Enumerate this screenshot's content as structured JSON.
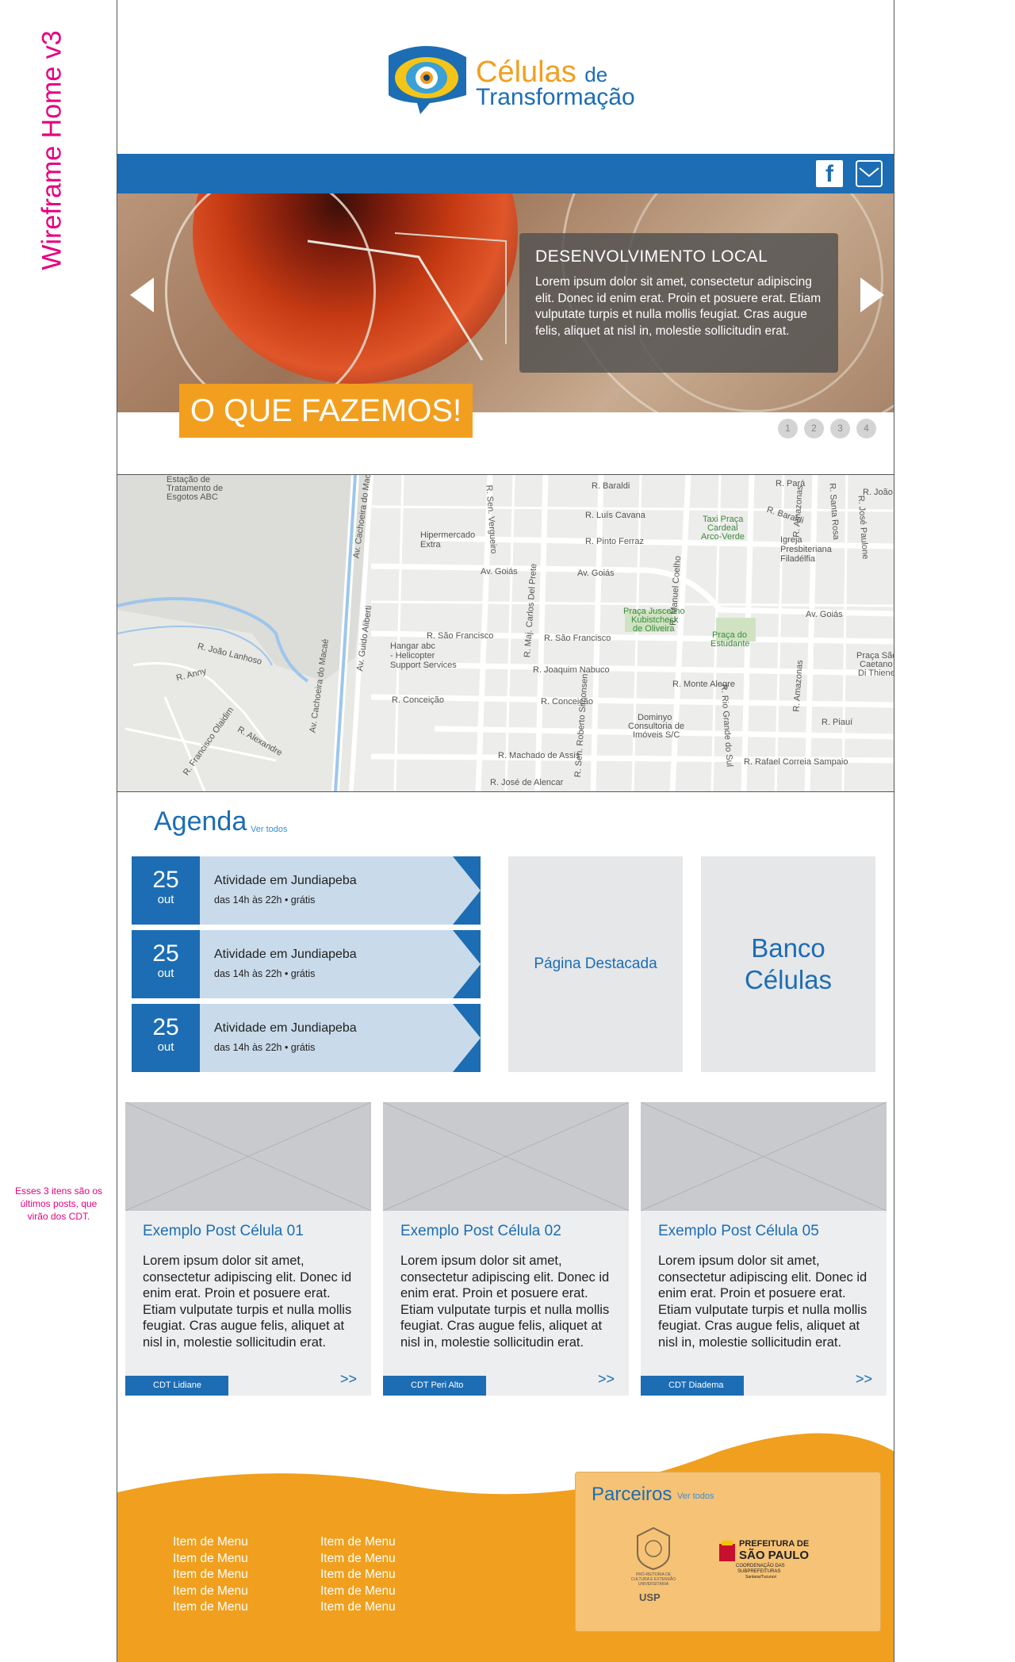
{
  "annotation": {
    "title": "Wireframe Home v3",
    "side_note": "Esses 3 itens são os últimos posts, que virão dos CDT."
  },
  "header": {
    "logo_line1": "Células",
    "logo_line1_small": "de",
    "logo_line2": "Transformação",
    "social": {
      "facebook_glyph": "f",
      "icons": [
        "facebook-icon",
        "mail-icon"
      ]
    }
  },
  "hero": {
    "caption_title": "DESENVOLVIMENTO LOCAL",
    "caption_body": "Lorem ipsum dolor sit amet, consectetur adipiscing elit. Donec id enim erat. Proin et posuere erat. Etiam vulputate turpis et nulla mollis feugiat. Cras augue felis, aliquet at nisl in, molestie sollicitudin erat.",
    "cta_label": "O QUE FAZEMOS!",
    "pages": [
      "1",
      "2",
      "3",
      "4"
    ]
  },
  "map": {
    "labels": {
      "estacao": "Estação de",
      "tratamento": "Tratamento de",
      "esgotos": "Esgotos ABC",
      "hiper1": "Hipermercado",
      "hiper2": "Extra",
      "goias1": "Av. Goiás",
      "goias2": "Av. Goiás",
      "goias3": "Av. Goiás",
      "baraldi1": "R. Baraldi",
      "baraldi2": "R. Baraldi",
      "luis": "R. Luís Cavana",
      "pinto": "R. Pinto Ferraz",
      "saofrancisco1": "R. São Francisco",
      "saofrancisco2": "R. São Francisco",
      "hangar1": "Hangar abc",
      "hangar2": "- Helicopter",
      "hangar3": "Support Services",
      "joaquim": "R. Joaquim Nabuco",
      "conceicao1": "R. Conceição",
      "conceicao2": "R. Conceição",
      "machado": "R. Machado de Assis",
      "jose": "R. José de Alencar",
      "praca1": "Praça Juscelino",
      "praca2": "Kubistcheck",
      "praca3": "de Oliveira",
      "praca_est1": "Praça do",
      "praca_est2": "Estudante",
      "taxi1": "Taxi Praça",
      "taxi2": "Cardeal",
      "taxi3": "Arco-Verde",
      "igreja1": "Igreja",
      "igreja2": "Presbiteriana",
      "igreja3": "Filadélfia",
      "montealegre": "R. Monte Alegre",
      "dominyo1": "Dominyo",
      "dominyo2": "Consultoria de",
      "dominyo3": "Imóveis S/C",
      "rafael": "R. Rafael Correia Sampaio",
      "piaui": "R. Piauí",
      "para": "R. Pará",
      "joao": "R. João",
      "lanhoso": "R. João Lanhoso",
      "anny": "R. Anny",
      "alexandre": "R. Alexandre",
      "olavo": "R. Francisco Olaidim",
      "pracasao1": "Praça São",
      "pracasao2": "Caetano",
      "pracasao3": "Di Thiene",
      "cachoeira": "Av. Cachoeira do Macaé",
      "guido": "Av. Guido Aliberti",
      "verguero": "R. Sen. Vergueiro",
      "delprete": "R. Maj. Carlos Del Prete",
      "simonsen": "R. Sen. Roberto Simonsen",
      "coelho": "R. Manuel Coelho",
      "amazonas": "R. Amazonas",
      "amazonas2": "R. Amazonas",
      "santarosa": "R. Santa Rosa",
      "paulone": "R. José Paulone",
      "riogrande": "R. Rio Grande do Sul"
    }
  },
  "agenda": {
    "title": "Agenda",
    "see_all": "Ver todos",
    "events": [
      {
        "day": "25",
        "month": "out",
        "title": "Atividade em Jundiapeba",
        "time": "das 14h às 22h • grátis"
      },
      {
        "day": "25",
        "month": "out",
        "title": "Atividade em Jundiapeba",
        "time": "das 14h às 22h • grátis"
      },
      {
        "day": "25",
        "month": "out",
        "title": "Atividade em Jundiapeba",
        "time": "das 14h às 22h • grátis"
      }
    ],
    "featured_page": "Página Destacada",
    "bank_line1": "Banco",
    "bank_line2": "Células"
  },
  "posts": [
    {
      "title": "Exemplo Post Célula 01",
      "body": "Lorem ipsum dolor sit amet, consectetur adipiscing elit. Donec id enim erat. Proin et posuere erat. Etiam vulputate turpis et nulla mollis feugiat. Cras augue felis, aliquet at nisl in, molestie sollicitudin erat.",
      "tag": "CDT Lidiane",
      "more": ">>"
    },
    {
      "title": "Exemplo Post Célula 02",
      "body": "Lorem ipsum dolor sit amet, consectetur adipiscing elit. Donec id enim erat. Proin et posuere erat. Etiam vulputate turpis et nulla mollis feugiat. Cras augue felis, aliquet at nisl in, molestie sollicitudin erat.",
      "tag": "CDT Peri Alto",
      "more": ">>"
    },
    {
      "title": "Exemplo Post Célula 05",
      "body": "Lorem ipsum dolor sit amet, consectetur adipiscing elit. Donec id enim erat. Proin et posuere erat. Etiam vulputate turpis et nulla mollis feugiat. Cras augue felis, aliquet at nisl in, molestie sollicitudin erat.",
      "tag": "CDT Diadema",
      "more": ">>"
    }
  ],
  "footer": {
    "menu_col1": [
      "Item de Menu",
      "Item de Menu",
      "Item de Menu",
      "Item de Menu",
      "Item de Menu"
    ],
    "menu_col2": [
      "Item de Menu",
      "Item de Menu",
      "Item de Menu",
      "Item de Menu",
      "Item de Menu"
    ],
    "partners_title": "Parceiros",
    "partners_see_all": "Ver todos",
    "usp_line1": "PRÓ-REITORIA DE",
    "usp_line2": "CULTURA E EXTENSÃO",
    "usp_line3": "UNIVERSITÁRIA",
    "usp_name": "USP",
    "sp_line1": "PREFEITURA DE",
    "sp_line2": "SÃO PAULO",
    "sp_line3": "COORDENAÇÃO DAS",
    "sp_line4": "SUBPREFEITURAS",
    "sp_line5": "Santana/Tucuruvi"
  },
  "colors": {
    "brand_blue": "#1c6db4",
    "brand_orange": "#f29f1f",
    "annotation_pink": "#e6007e"
  }
}
